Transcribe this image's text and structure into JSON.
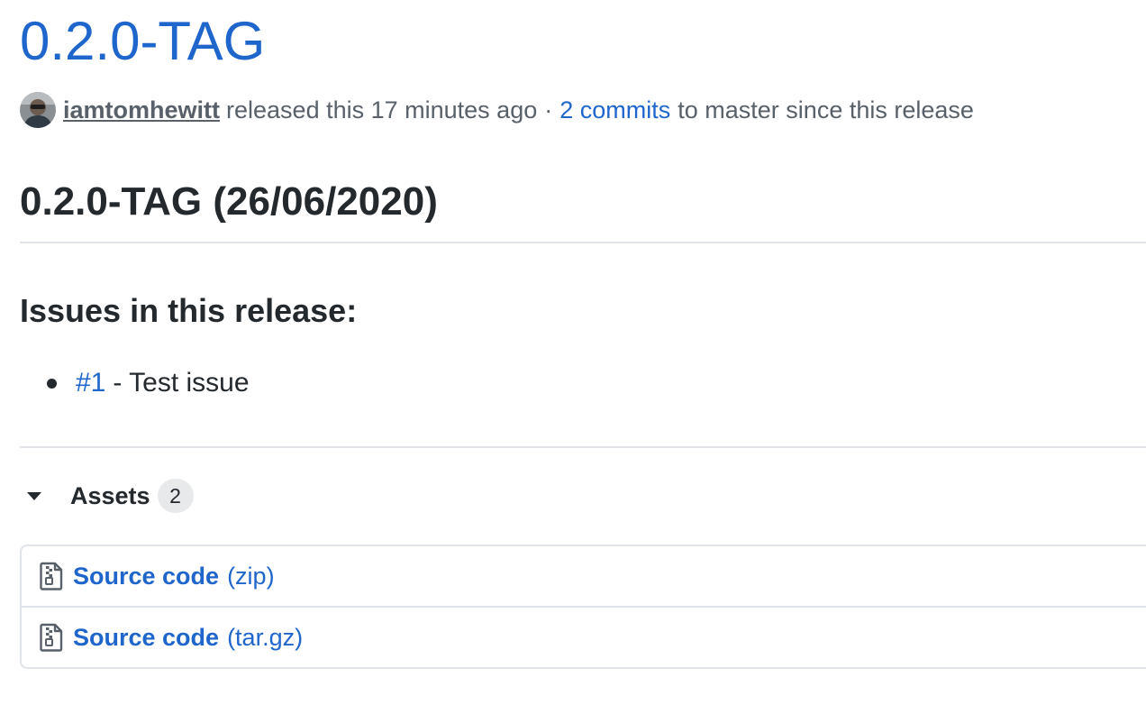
{
  "release": {
    "title": "0.2.0-TAG",
    "author": "iamtomhewitt",
    "released_text": "released this 17 minutes ago",
    "separator": "·",
    "commits_link": "2 commits",
    "commits_suffix": "to master since this release"
  },
  "body": {
    "heading": "0.2.0-TAG (26/06/2020)",
    "subheading": "Issues in this release:",
    "issues": [
      {
        "link": "#1",
        "description": "- Test issue"
      }
    ]
  },
  "assets": {
    "label": "Assets",
    "count": "2",
    "items": [
      {
        "name": "Source code",
        "ext": "(zip)",
        "icon": "file-zip-icon"
      },
      {
        "name": "Source code",
        "ext": "(tar.gz)",
        "icon": "file-zip-icon"
      }
    ]
  },
  "colors": {
    "link": "#1f66cc",
    "text": "#24292e",
    "muted": "#586069",
    "border": "#e1e4e8"
  }
}
